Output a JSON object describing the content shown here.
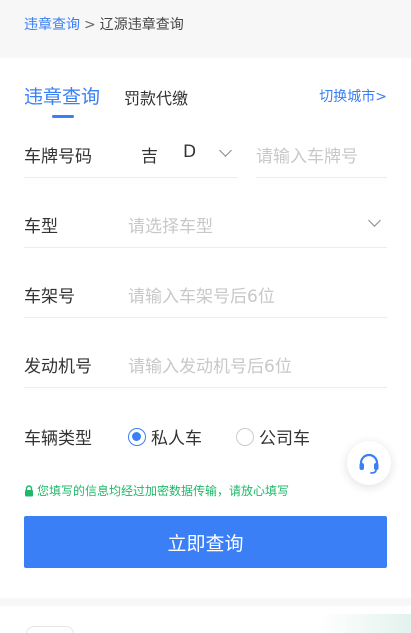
{
  "breadcrumb": {
    "link": "违章查询",
    "separator": ">",
    "current": "辽源违章查询"
  },
  "tabs": {
    "active": "违章查询",
    "second": "罚款代缴",
    "switch_city": "切换城市>"
  },
  "form": {
    "plate_label": "车牌号码",
    "plate_province": "吉",
    "plate_letter": "D",
    "plate_placeholder": "请输入车牌号",
    "type_label": "车型",
    "type_placeholder": "请选择车型",
    "frame_label": "车架号",
    "frame_placeholder": "请输入车架号后6位",
    "engine_label": "发动机号",
    "engine_placeholder": "请输入发动机号后6位",
    "vehicle_kind_label": "车辆类型",
    "vehicle_kind_options": [
      "私人车",
      "公司车"
    ],
    "vehicle_kind_selected": "私人车"
  },
  "security_note": "您填写的信息均经过加密数据传输，请放心填写",
  "submit_label": "立即查询",
  "icons": {
    "dropdown": "chevron-down-icon",
    "lock": "lock-icon",
    "support": "headset-icon"
  },
  "colors": {
    "accent": "#3a7ff6",
    "secure_green": "#1fb86a",
    "placeholder": "#c8c8c8"
  }
}
